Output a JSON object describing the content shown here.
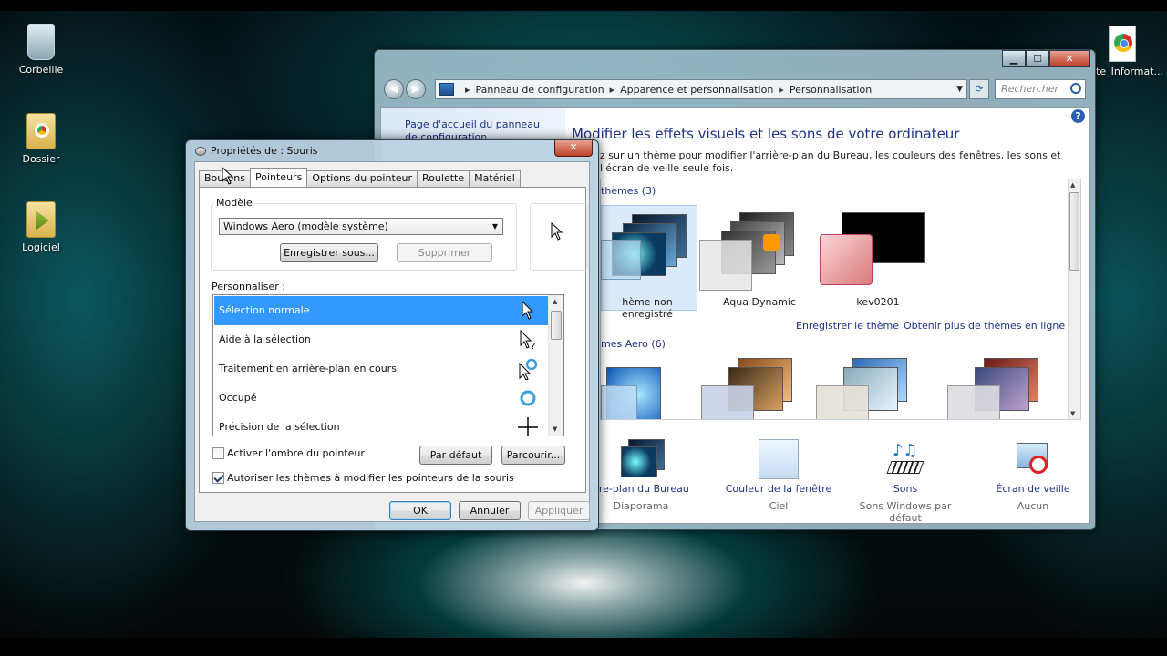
{
  "desktop": {
    "icons": [
      {
        "label": "Corbeille",
        "icon": "recycle-bin-icon"
      },
      {
        "label": "Dossier",
        "icon": "folder-chrome-icon"
      },
      {
        "label": "Logiciel",
        "icon": "folder-media-icon"
      },
      {
        "label": "te_Informat...",
        "icon": "chrome-file-icon"
      }
    ]
  },
  "explorer": {
    "breadcrumb": [
      "Panneau de configuration",
      "Apparence et personnalisation",
      "Personnalisation"
    ],
    "search_placeholder": "Rechercher",
    "left_link": "Page d'accueil du panneau de configuration",
    "title": "Modifier les effets visuels et les sons de votre ordinateur",
    "description": "z sur un thème pour modifier l'arrière-plan du Bureau, les couleurs des fenêtres, les sons et l'écran de veille seule fois.",
    "my_themes_header": "thèmes (3)",
    "aero_themes_header": "mes Aero (6)",
    "themes": [
      {
        "label": "hème non enregistré",
        "selected": true
      },
      {
        "label": "Aqua Dynamic",
        "selected": false
      },
      {
        "label": "kev0201",
        "selected": false
      }
    ],
    "save_theme_link": "Enregistrer le thème",
    "more_themes_link": "Obtenir plus de thèmes en ligne",
    "bottom": [
      {
        "label": "ère-plan du Bureau",
        "sub": "Diaporama"
      },
      {
        "label": "Couleur de la fenêtre",
        "sub": "Ciel"
      },
      {
        "label": "Sons",
        "sub": "Sons Windows par défaut"
      },
      {
        "label": "Écran de veille",
        "sub": "Aucun"
      }
    ]
  },
  "dialog": {
    "title": "Propriétés de : Souris",
    "tabs": [
      "Boutons",
      "Pointeurs",
      "Options du pointeur",
      "Roulette",
      "Matériel"
    ],
    "active_tab": "Pointeurs",
    "model_group": "Modèle",
    "model_value": "Windows Aero (modèle système)",
    "save_as": "Enregistrer sous...",
    "delete": "Supprimer",
    "customize_label": "Personnaliser :",
    "cursors": [
      {
        "label": "Sélection normale",
        "selected": true
      },
      {
        "label": "Aide à la sélection",
        "selected": false
      },
      {
        "label": "Traitement en arrière-plan en cours",
        "selected": false
      },
      {
        "label": "Occupé",
        "selected": false
      },
      {
        "label": "Précision de la sélection",
        "selected": false
      }
    ],
    "shadow_checkbox": {
      "label": "Activer l'ombre du pointeur",
      "checked": false
    },
    "themes_checkbox": {
      "label": "Autoriser les thèmes à modifier les pointeurs de la souris",
      "checked": true
    },
    "default_btn": "Par défaut",
    "browse_btn": "Parcourir...",
    "ok": "OK",
    "cancel": "Annuler",
    "apply": "Appliquer"
  }
}
